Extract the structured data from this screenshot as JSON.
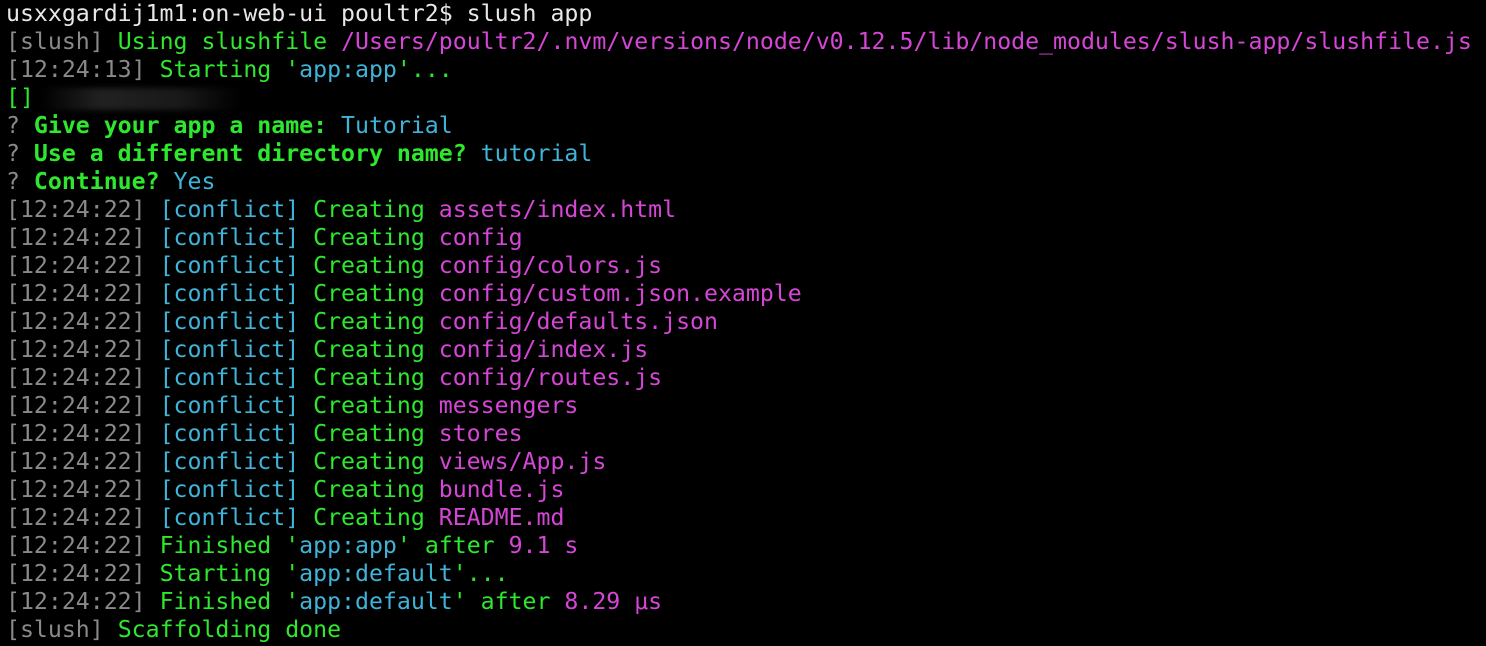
{
  "colors": {
    "background": "#000000",
    "white": "#e8e8e8",
    "gray": "#8a8a8a",
    "green": "#2ee82e",
    "cyan": "#3fb4d8",
    "magenta": "#d646d6"
  },
  "terminal": {
    "lines": [
      {
        "segments": [
          {
            "text": "usxxgardij1m1:on-web-ui poultr2$ slush app",
            "color": "white"
          }
        ]
      },
      {
        "segments": [
          {
            "text": "[",
            "color": "gray"
          },
          {
            "text": "slush",
            "color": "gray"
          },
          {
            "text": "] ",
            "color": "gray"
          },
          {
            "text": "Using slushfile ",
            "color": "green"
          },
          {
            "text": "/Users/poultr2/.nvm/versions/node/v0.12.5/lib/node_modules/slush-app/slushfile.js",
            "color": "magenta"
          }
        ]
      },
      {
        "segments": [
          {
            "text": "[12:24:13] ",
            "color": "gray"
          },
          {
            "text": "Starting '",
            "color": "green"
          },
          {
            "text": "app:app",
            "color": "cyan"
          },
          {
            "text": "'...",
            "color": "green"
          }
        ]
      },
      {
        "segments": [
          {
            "text": "[]",
            "color": "green"
          }
        ],
        "blurred": true
      },
      {
        "segments": [
          {
            "text": "? ",
            "color": "gray"
          },
          {
            "text": "Give your app a name: ",
            "color": "green",
            "bold": true
          },
          {
            "text": "Tutorial",
            "color": "cyan"
          }
        ]
      },
      {
        "segments": [
          {
            "text": "? ",
            "color": "gray"
          },
          {
            "text": "Use a different directory name? ",
            "color": "green",
            "bold": true
          },
          {
            "text": "tutorial",
            "color": "cyan"
          }
        ]
      },
      {
        "segments": [
          {
            "text": "? ",
            "color": "gray"
          },
          {
            "text": "Continue? ",
            "color": "green",
            "bold": true
          },
          {
            "text": "Yes",
            "color": "cyan"
          }
        ]
      },
      {
        "segments": [
          {
            "text": "[12:24:22] ",
            "color": "gray"
          },
          {
            "text": "[conflict] ",
            "color": "cyan"
          },
          {
            "text": "Creating ",
            "color": "green"
          },
          {
            "text": "assets/index.html",
            "color": "magenta"
          }
        ]
      },
      {
        "segments": [
          {
            "text": "[12:24:22] ",
            "color": "gray"
          },
          {
            "text": "[conflict] ",
            "color": "cyan"
          },
          {
            "text": "Creating ",
            "color": "green"
          },
          {
            "text": "config",
            "color": "magenta"
          }
        ]
      },
      {
        "segments": [
          {
            "text": "[12:24:22] ",
            "color": "gray"
          },
          {
            "text": "[conflict] ",
            "color": "cyan"
          },
          {
            "text": "Creating ",
            "color": "green"
          },
          {
            "text": "config/colors.js",
            "color": "magenta"
          }
        ]
      },
      {
        "segments": [
          {
            "text": "[12:24:22] ",
            "color": "gray"
          },
          {
            "text": "[conflict] ",
            "color": "cyan"
          },
          {
            "text": "Creating ",
            "color": "green"
          },
          {
            "text": "config/custom.json.example",
            "color": "magenta"
          }
        ]
      },
      {
        "segments": [
          {
            "text": "[12:24:22] ",
            "color": "gray"
          },
          {
            "text": "[conflict] ",
            "color": "cyan"
          },
          {
            "text": "Creating ",
            "color": "green"
          },
          {
            "text": "config/defaults.json",
            "color": "magenta"
          }
        ]
      },
      {
        "segments": [
          {
            "text": "[12:24:22] ",
            "color": "gray"
          },
          {
            "text": "[conflict] ",
            "color": "cyan"
          },
          {
            "text": "Creating ",
            "color": "green"
          },
          {
            "text": "config/index.js",
            "color": "magenta"
          }
        ]
      },
      {
        "segments": [
          {
            "text": "[12:24:22] ",
            "color": "gray"
          },
          {
            "text": "[conflict] ",
            "color": "cyan"
          },
          {
            "text": "Creating ",
            "color": "green"
          },
          {
            "text": "config/routes.js",
            "color": "magenta"
          }
        ]
      },
      {
        "segments": [
          {
            "text": "[12:24:22] ",
            "color": "gray"
          },
          {
            "text": "[conflict] ",
            "color": "cyan"
          },
          {
            "text": "Creating ",
            "color": "green"
          },
          {
            "text": "messengers",
            "color": "magenta"
          }
        ]
      },
      {
        "segments": [
          {
            "text": "[12:24:22] ",
            "color": "gray"
          },
          {
            "text": "[conflict] ",
            "color": "cyan"
          },
          {
            "text": "Creating ",
            "color": "green"
          },
          {
            "text": "stores",
            "color": "magenta"
          }
        ]
      },
      {
        "segments": [
          {
            "text": "[12:24:22] ",
            "color": "gray"
          },
          {
            "text": "[conflict] ",
            "color": "cyan"
          },
          {
            "text": "Creating ",
            "color": "green"
          },
          {
            "text": "views/App.js",
            "color": "magenta"
          }
        ]
      },
      {
        "segments": [
          {
            "text": "[12:24:22] ",
            "color": "gray"
          },
          {
            "text": "[conflict] ",
            "color": "cyan"
          },
          {
            "text": "Creating ",
            "color": "green"
          },
          {
            "text": "bundle.js",
            "color": "magenta"
          }
        ]
      },
      {
        "segments": [
          {
            "text": "[12:24:22] ",
            "color": "gray"
          },
          {
            "text": "[conflict] ",
            "color": "cyan"
          },
          {
            "text": "Creating ",
            "color": "green"
          },
          {
            "text": "README.md",
            "color": "magenta"
          }
        ]
      },
      {
        "segments": [
          {
            "text": "[12:24:22] ",
            "color": "gray"
          },
          {
            "text": "Finished '",
            "color": "green"
          },
          {
            "text": "app:app",
            "color": "cyan"
          },
          {
            "text": "' after ",
            "color": "green"
          },
          {
            "text": "9.1 s",
            "color": "magenta"
          }
        ]
      },
      {
        "segments": [
          {
            "text": "[12:24:22] ",
            "color": "gray"
          },
          {
            "text": "Starting '",
            "color": "green"
          },
          {
            "text": "app:default",
            "color": "cyan"
          },
          {
            "text": "'...",
            "color": "green"
          }
        ]
      },
      {
        "segments": [
          {
            "text": "[12:24:22] ",
            "color": "gray"
          },
          {
            "text": "Finished '",
            "color": "green"
          },
          {
            "text": "app:default",
            "color": "cyan"
          },
          {
            "text": "' after ",
            "color": "green"
          },
          {
            "text": "8.29 μs",
            "color": "magenta"
          }
        ]
      },
      {
        "segments": [
          {
            "text": "[slush] ",
            "color": "gray"
          },
          {
            "text": "Scaffolding done",
            "color": "green"
          }
        ]
      }
    ]
  }
}
